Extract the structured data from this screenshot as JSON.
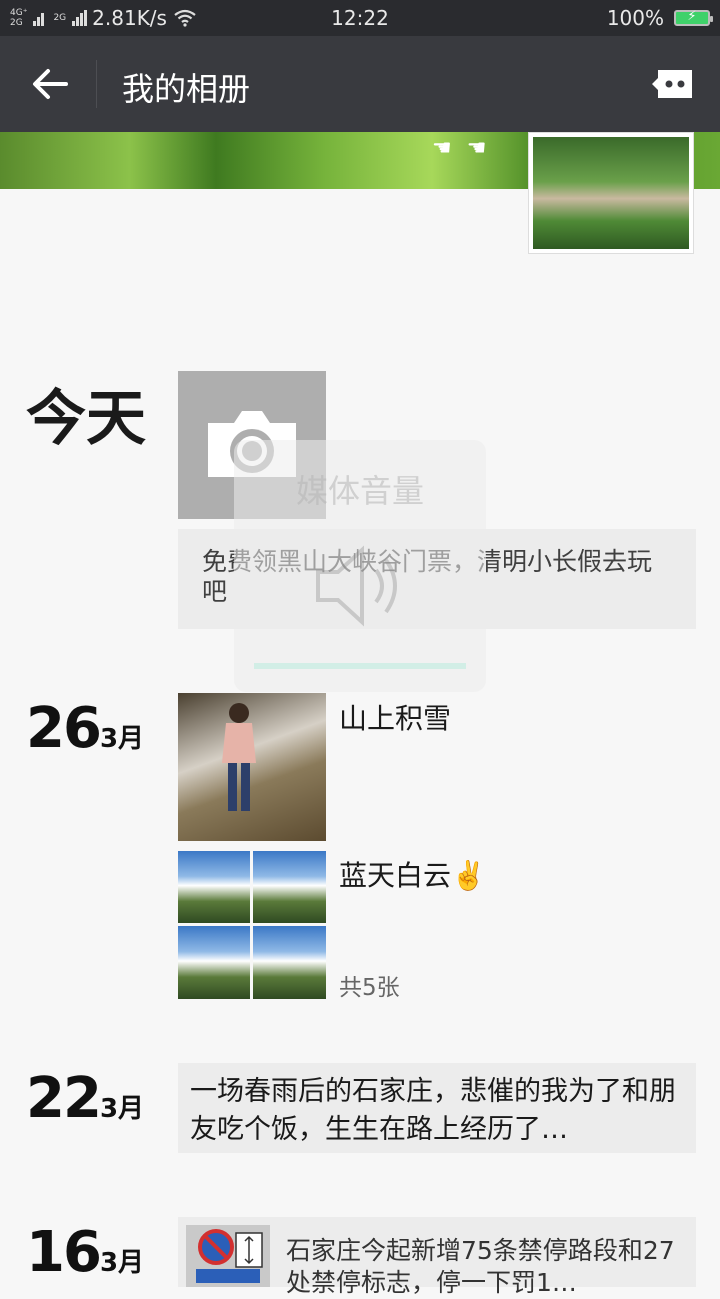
{
  "status_bar": {
    "network_top": "4G⁺",
    "network_bottom": "2G",
    "network2": "2G",
    "speed": "2.81K/s",
    "time": "12:22",
    "battery": "100%"
  },
  "header": {
    "title": "我的相册"
  },
  "cover": {
    "hands_glyph": "☚ ☚"
  },
  "timeline": {
    "today_label": "今天",
    "ad_text": "免费领黑山大峡谷门票，清明小长假去玩吧",
    "entries": [
      {
        "day": "26",
        "month": "3月",
        "posts": [
          {
            "caption": "山上积雪"
          },
          {
            "caption": "蓝天白云✌️",
            "count": "共5张"
          }
        ]
      },
      {
        "day": "22",
        "month": "3月",
        "text": "一场春雨后的石家庄，悲催的我为了和朋友吃个饭，生生在路上经历了…"
      },
      {
        "day": "16",
        "month": "3月",
        "news_text": "石家庄今起新增75条禁停路段和27处禁停标志，停一下罚1…"
      }
    ]
  },
  "volume_overlay": {
    "title": "媒体音量",
    "level": 1.0
  }
}
